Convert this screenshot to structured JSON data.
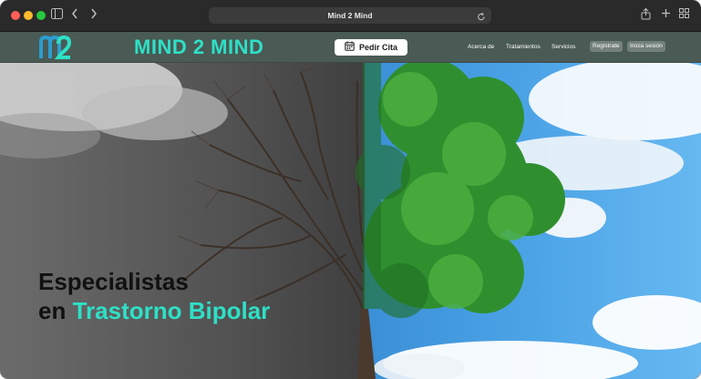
{
  "browser": {
    "address_text": "Mind 2 Mind"
  },
  "site": {
    "brand": "MIND 2 MIND",
    "cta_label": "Pedir Cita",
    "nav_links": [
      "Acerca de",
      "Tratamientos",
      "Servicios"
    ],
    "register_label": "Registrate",
    "login_label": "Inicia sesión"
  },
  "hero": {
    "headline_line1": "Especialistas",
    "headline_line2_prefix": "en ",
    "headline_line2_highlight": "Trastorno Bipolar"
  },
  "colors": {
    "accent": "#2ee0c6",
    "nav_bg": "#4a5a55",
    "pill_bg": "#73807c"
  }
}
